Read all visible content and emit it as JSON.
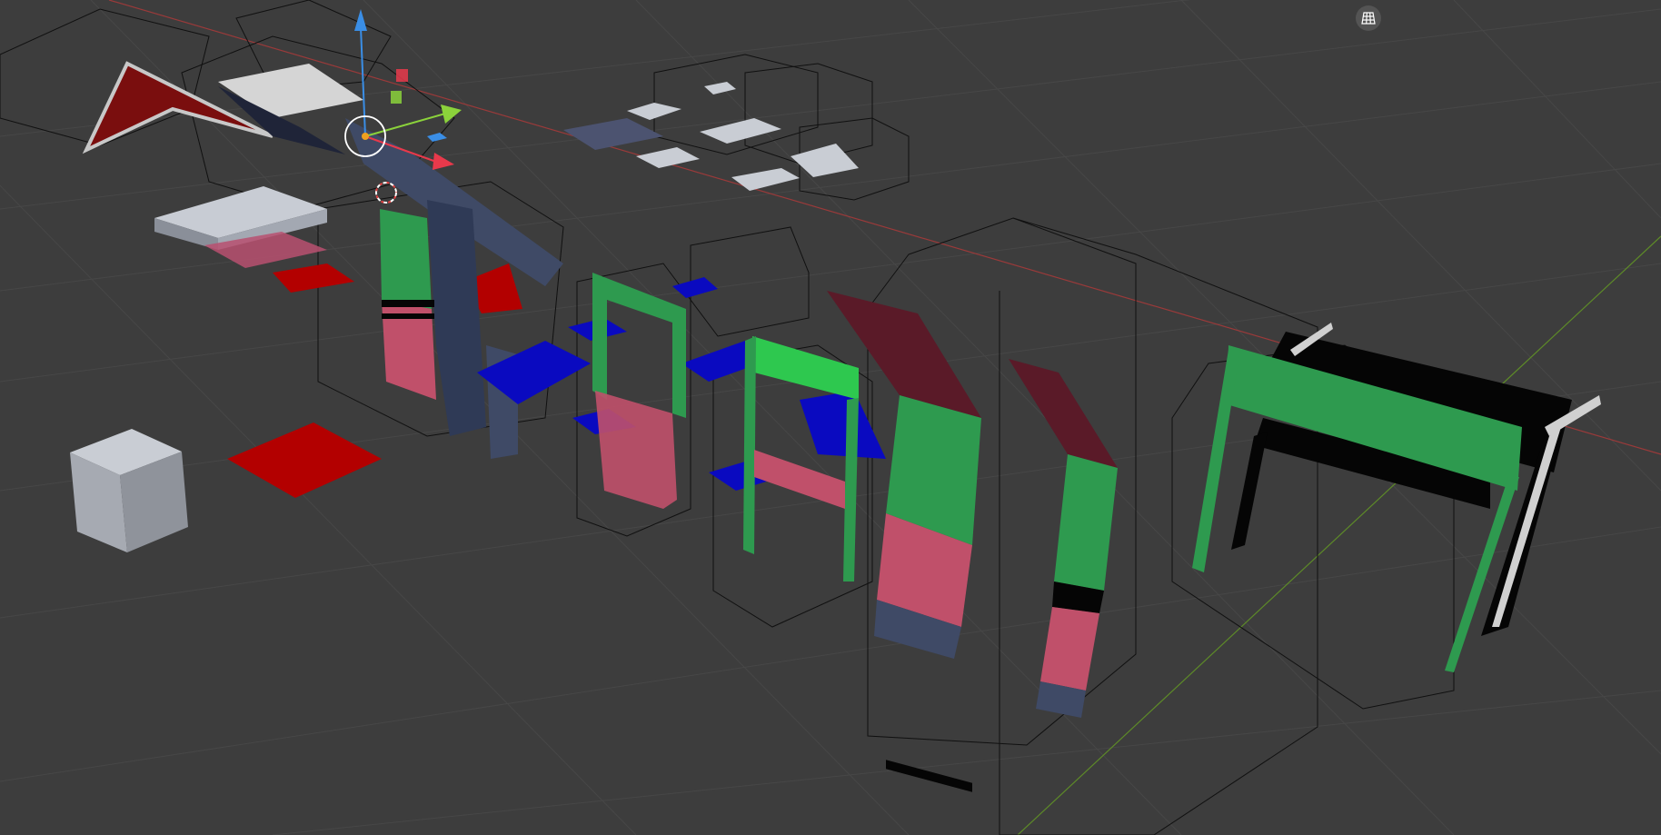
{
  "viewport": {
    "mode": "3D Viewport",
    "shading": "solid",
    "overlays": {
      "grid_floor": true,
      "x_axis_color": "#c04a4a",
      "y_axis_color": "#6da02d"
    },
    "background_color": "#3d3d3d"
  },
  "navigation": {
    "ortho_toggle_icon": "grid-perspective-icon"
  },
  "gizmo": {
    "type": "move",
    "x_color": "#e8394b",
    "y_color": "#8bd23b",
    "z_color": "#3a8ee6"
  },
  "materials": {
    "red": "#b30000",
    "pink": "#c0506a",
    "green": "#2e9a4f",
    "blue": "#0a0ac0",
    "dark_slate": "#3f4a66",
    "maroon": "#5a1a28",
    "white": "#d0d0d0",
    "black": "#050505"
  }
}
